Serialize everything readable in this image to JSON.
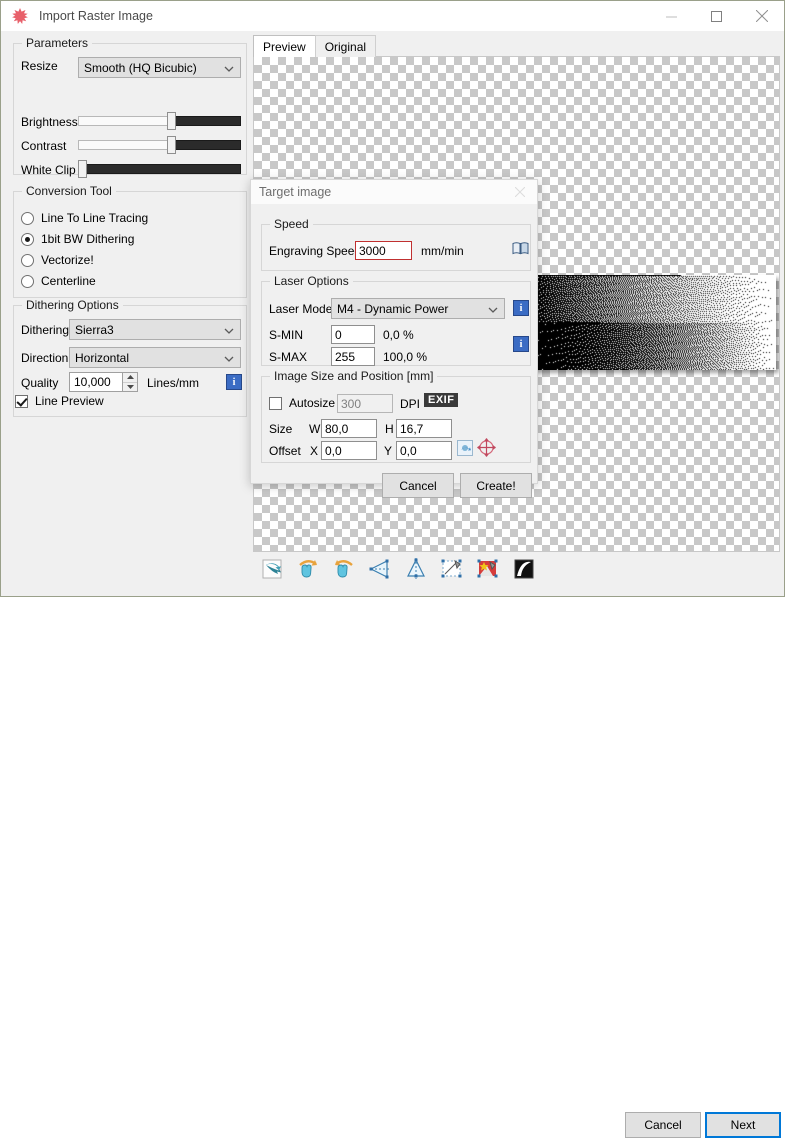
{
  "window": {
    "title": "Import Raster Image",
    "app_icon": "maple-leaf-icon",
    "minimize_label": "Minimize",
    "maximize_label": "Maximize",
    "close_label": "Close"
  },
  "parameters": {
    "group_title": "Parameters",
    "resize_label": "Resize",
    "resize_value": "Smooth (HQ Bicubic)",
    "brightness_label": "Brightness",
    "brightness_percent": 57,
    "contrast_label": "Contrast",
    "contrast_percent": 57,
    "white_clip_label": "White Clip",
    "white_clip_percent": 1
  },
  "conversion_tool": {
    "group_title": "Conversion Tool",
    "options": [
      {
        "label": "Line To Line Tracing",
        "selected": false
      },
      {
        "label": "1bit BW Dithering",
        "selected": true
      },
      {
        "label": "Vectorize!",
        "selected": false
      },
      {
        "label": "Centerline",
        "selected": false
      }
    ]
  },
  "dithering_options": {
    "group_title": "Dithering Options",
    "dithering_label": "Dithering",
    "dithering_value": "Sierra3",
    "direction_label": "Direction",
    "direction_value": "Horizontal",
    "quality_label": "Quality",
    "quality_value": "10,000",
    "quality_units": "Lines/mm",
    "quality_info_icon": "info-icon",
    "line_preview_label": "Line Preview",
    "line_preview_checked": true
  },
  "preview": {
    "tabs": [
      {
        "label": "Preview",
        "active": true
      },
      {
        "label": "Original",
        "active": false
      }
    ]
  },
  "toolbar": {
    "icons": [
      {
        "name": "flip-page-icon"
      },
      {
        "name": "rotate-left-icon"
      },
      {
        "name": "rotate-right-icon"
      },
      {
        "name": "mirror-horizontal-icon"
      },
      {
        "name": "mirror-vertical-icon"
      },
      {
        "name": "crop-icon"
      },
      {
        "name": "color-adjust-icon"
      },
      {
        "name": "invert-icon"
      }
    ]
  },
  "footer": {
    "cancel_label": "Cancel",
    "next_label": "Next"
  },
  "dialog": {
    "title": "Target image",
    "speed": {
      "group_title": "Speed",
      "engraving_speed_label": "Engraving Speed",
      "engraving_speed_value": "3000",
      "units": "mm/min",
      "manual_icon": "book-icon"
    },
    "laser_options": {
      "group_title": "Laser Options",
      "laser_mode_label": "Laser Mode",
      "laser_mode_value": "M4 - Dynamic Power",
      "laser_mode_info_icon": "info-icon",
      "smin_label": "S-MIN",
      "smin_value": "0",
      "smin_percent": "0,0 %",
      "smax_label": "S-MAX",
      "smax_value": "255",
      "smax_percent": "100,0 %",
      "s_info_icon": "info-icon"
    },
    "image_size": {
      "group_title": "Image Size and Position [mm]",
      "autosize_label": "Autosize",
      "autosize_checked": false,
      "dpi_value": "300",
      "dpi_label": "DPI",
      "exif_label": "EXIF",
      "size_label": "Size",
      "w_label": "W",
      "w_value": "80,0",
      "h_label": "H",
      "h_value": "16,7",
      "offset_label": "Offset",
      "x_label": "X",
      "x_value": "0,0",
      "y_label": "Y",
      "y_value": "0,0",
      "lock_ratio_icon": "lock-aspect-icon",
      "center_icon": "center-target-icon"
    },
    "cancel_label": "Cancel",
    "create_label": "Create!"
  },
  "colors": {
    "accent": "#0078d7",
    "info_blue": "#3b6cc4",
    "error_red": "#c03030",
    "window_border": "#9aa08a"
  }
}
